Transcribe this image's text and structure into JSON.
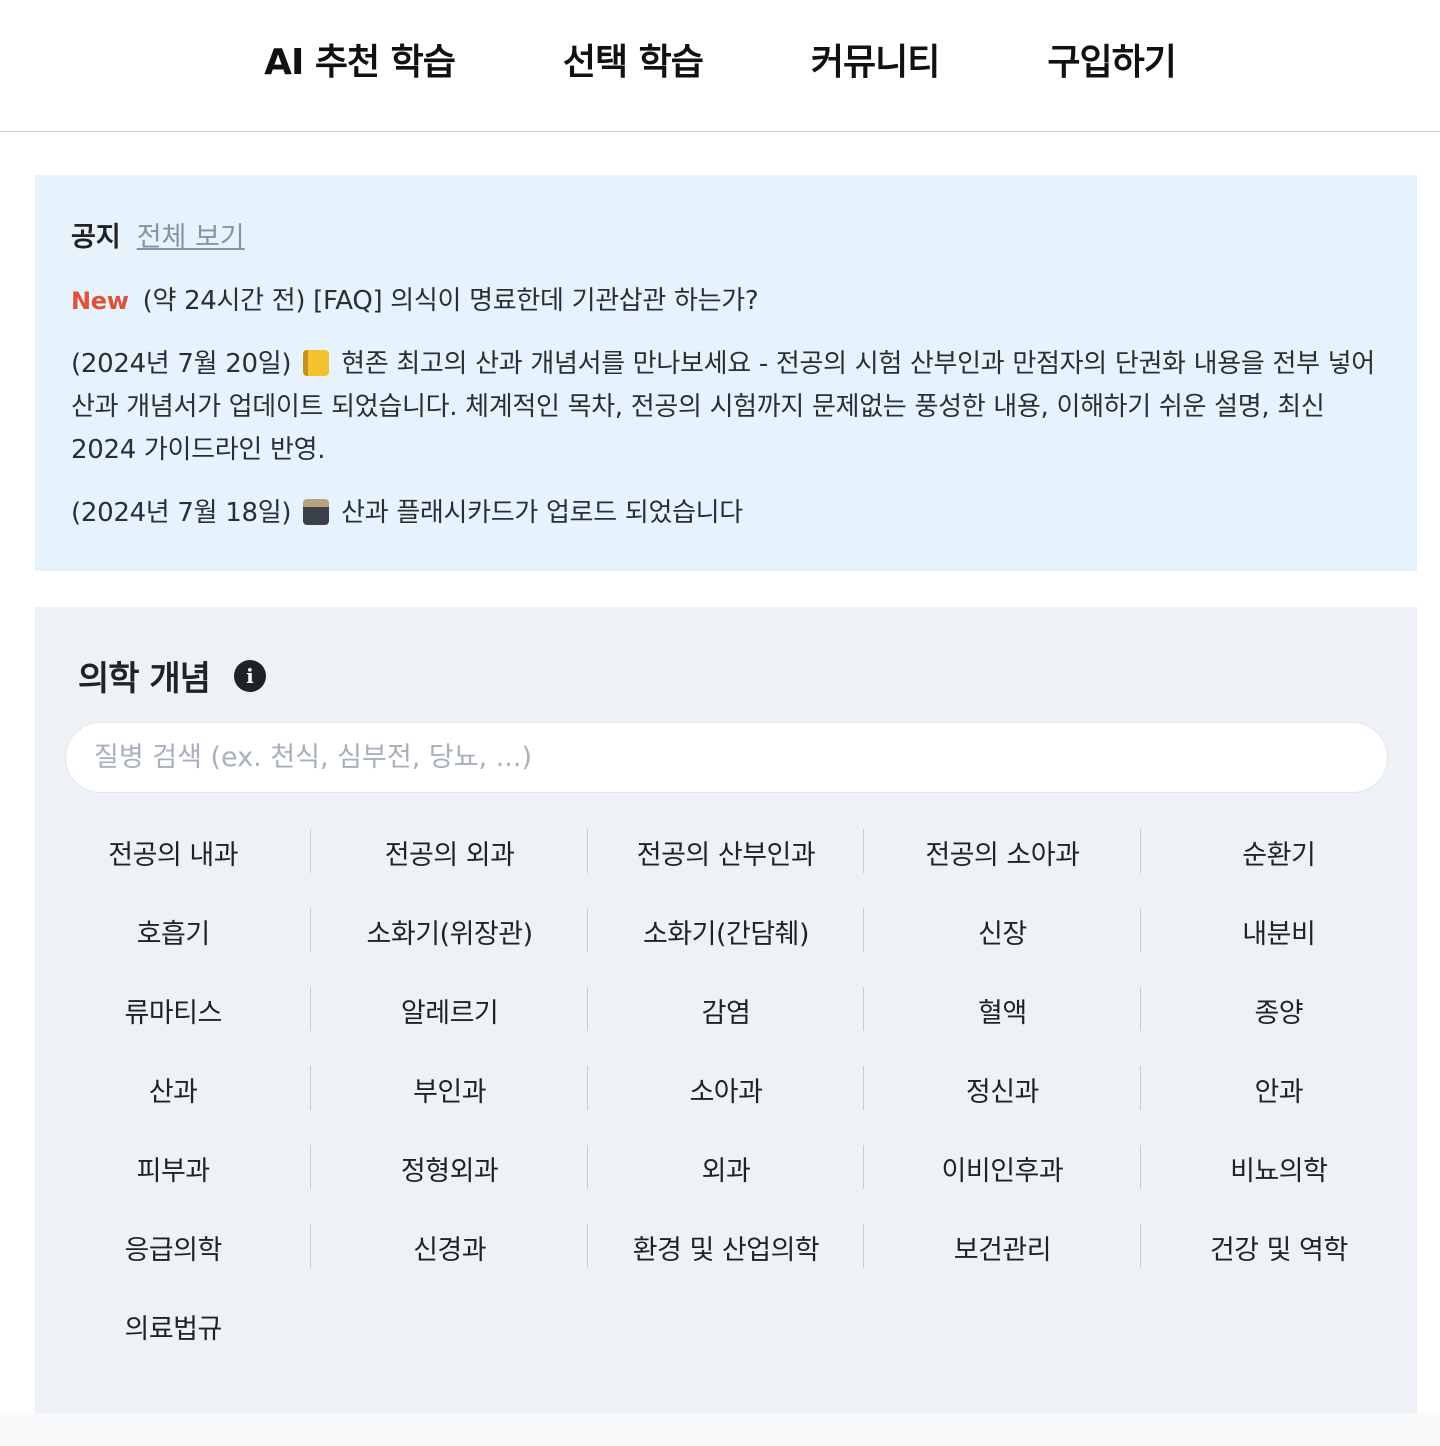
{
  "nav": {
    "items": [
      "AI 추천 학습",
      "선택 학습",
      "커뮤니티",
      "구입하기"
    ]
  },
  "notice": {
    "title": "공지",
    "view_all": "전체 보기",
    "new_label": "New",
    "item1": "(약 24시간 전) [FAQ] 의식이 명료한데 기관삽관 하는가?",
    "item2_prefix": "(2024년 7월 20일)",
    "item2_emoji": "ledger-icon",
    "item2_text": "현존 최고의 산과 개념서를 만나보세요 - 전공의 시험 산부인과 만점자의 단권화 내용을 전부 넣어 산과 개념서가 업데이트 되었습니다. 체계적인 목차, 전공의 시험까지 문제없는 풍성한 내용, 이해하기 쉬운 설명, 최신 2024 가이드라인 반영.",
    "item3_prefix": "(2024년 7월 18일)",
    "item3_emoji": "card-file-box-icon",
    "item3_text": "산과 플래시카드가 업로드 되었습니다"
  },
  "concepts": {
    "title": "의학 개념",
    "info_icon": "info-icon",
    "search_placeholder": "질병 검색 (ex. 천식, 심부전, 당뇨, ...)",
    "categories": [
      "전공의 내과",
      "전공의 외과",
      "전공의 산부인과",
      "전공의 소아과",
      "순환기",
      "호흡기",
      "소화기(위장관)",
      "소화기(간담췌)",
      "신장",
      "내분비",
      "류마티스",
      "알레르기",
      "감염",
      "혈액",
      "종양",
      "산과",
      "부인과",
      "소아과",
      "정신과",
      "안과",
      "피부과",
      "정형외과",
      "외과",
      "이비인후과",
      "비뇨의학",
      "응급의학",
      "신경과",
      "환경 및 산업의학",
      "보건관리",
      "건강 및 역학",
      "의료법규"
    ]
  },
  "colors": {
    "notice_bg": "#e6f2fc",
    "concepts_bg": "#eef1f5",
    "new_badge": "#e0513a"
  }
}
